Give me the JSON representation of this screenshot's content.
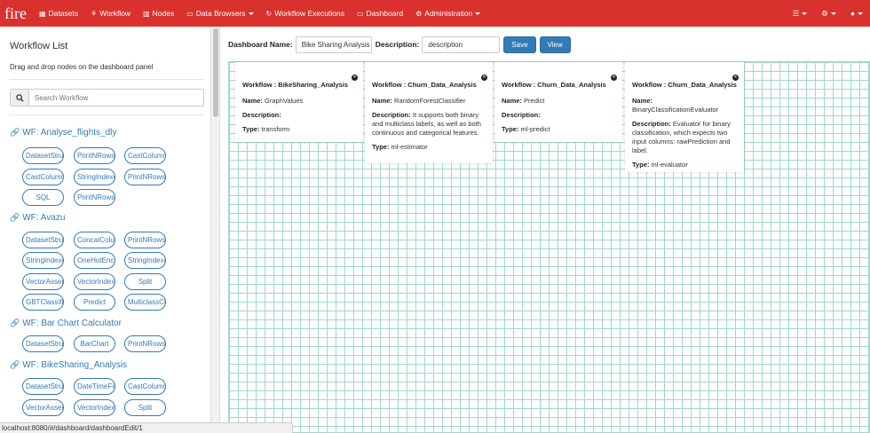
{
  "navbar": {
    "brand": "fire",
    "items": [
      {
        "label": "Datasets",
        "icon": "table-icon"
      },
      {
        "label": "Workflow",
        "icon": "sitemap-icon"
      },
      {
        "label": "Nodes",
        "icon": "chart-icon"
      },
      {
        "label": "Data Browsers",
        "icon": "folder-icon"
      },
      {
        "label": "Workflow Executions",
        "icon": "refresh-icon"
      },
      {
        "label": "Dashboard",
        "icon": "monitor-icon"
      },
      {
        "label": "Administration",
        "icon": "gear-icon"
      }
    ]
  },
  "sidebar": {
    "title": "Workflow List",
    "subtitle": "Drag and drop nodes on the dashboard panel",
    "search_placeholder": "Search Workflow",
    "groups": [
      {
        "title": "WF: Analyse_flights_dly",
        "nodes": [
          "DatasetStructure",
          "PrintNRows",
          "CastColumn",
          "CastColumn",
          "StringIndexer",
          "PrintNRows",
          "SQL",
          "PrintNRows"
        ]
      },
      {
        "title": "WF: Avazu",
        "nodes": [
          "DatasetStructure",
          "ConcatColumns",
          "PrintNRows",
          "StringIndexer",
          "OneHotEncoder",
          "StringIndexer",
          "VectorAssembler",
          "VectorIndexer",
          "Split",
          "GBTClassifier",
          "Predict",
          "MulticlassClassificationEvaluator"
        ]
      },
      {
        "title": "WF: Bar Chart Calculator",
        "nodes": [
          "DatasetStructure",
          "BarChart",
          "PrintNRows"
        ]
      },
      {
        "title": "WF: BikeSharing_Analysis",
        "nodes": [
          "DatasetStructure",
          "DateTimeFieldExtract",
          "CastColumn",
          "VectorAssembler",
          "VectorIndexer",
          "Split"
        ]
      }
    ]
  },
  "toolbar": {
    "name_label": "Dashboard Name:",
    "name_value": "Bike Sharing Analysis",
    "desc_label": "Description:",
    "desc_value": "description",
    "save_label": "Save",
    "view_label": "View"
  },
  "cards": [
    {
      "workflow": "Workflow : BikeSharing_Analysis",
      "name_label": "Name:",
      "name": "GraphValues",
      "desc_label": "Description:",
      "desc": "",
      "type_label": "Type:",
      "type": "transform"
    },
    {
      "workflow": "Workflow : Churn_Data_Analysis",
      "name_label": "Name:",
      "name": "RandomForestClassifier",
      "desc_label": "Description:",
      "desc": "It supports both binary and multiclass labels, as well as both continuous and categorical features.",
      "type_label": "Type:",
      "type": "ml-estimator"
    },
    {
      "workflow": "Workflow : Churn_Data_Analysis",
      "name_label": "Name:",
      "name": "Predict",
      "desc_label": "Description:",
      "desc": "",
      "type_label": "Type:",
      "type": "ml-predict"
    },
    {
      "workflow": "Workflow : Churn_Data_Analysis",
      "name_label": "Name:",
      "name": "BinaryClassificationEvaluator",
      "desc_label": "Description:",
      "desc": "Evaluator for binary classification, which expects two input columns: rawPrediction and label.",
      "type_label": "Type:",
      "type": "ml-evaluator"
    }
  ],
  "statusbar": {
    "url": "localhost:8080/#/dashboard/dashboardEdit/1"
  }
}
